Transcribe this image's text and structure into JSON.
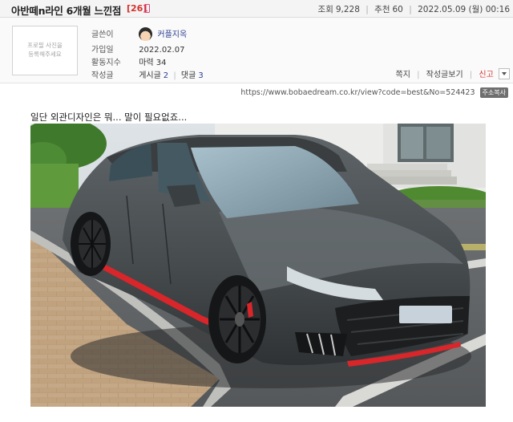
{
  "post": {
    "title": "아반떼n라인 6개월 느낀점",
    "comment_count": "[26]",
    "stats": {
      "views_label": "조회",
      "views": "9,228",
      "recommend_label": "추천",
      "recommend": "60",
      "date": "2022.05.09 (월) 00:16"
    }
  },
  "author": {
    "profile_placeholder_line1": "프로필 사진을",
    "profile_placeholder_line2": "등록해주세요",
    "writer_label": "글쓴이",
    "nickname": "커플지옥",
    "joined_label": "가입일",
    "joined": "2022.02.07",
    "activity_label": "활동지수",
    "activity": "마력 34",
    "posts_label": "작성글",
    "posts_text": "게시글",
    "posts_count": "2",
    "comments_text": "댓글",
    "comments_count": "3"
  },
  "actions": {
    "note": "쪽지",
    "view_posts": "작성글보기",
    "report": "신고"
  },
  "url": {
    "text": "https://www.bobaedream.co.kr/view?code=best&No=524423",
    "copy_label": "주소복사"
  },
  "content": {
    "text": "일단 외관디자인은 뭐... 말이 필요없죠..."
  },
  "icons": {
    "mobile": "mobile-phone-icon",
    "dropdown": "chevron-down-icon"
  },
  "colors": {
    "comment_count": "#d2322d",
    "nickname": "#2a3d8f",
    "report": "#d2322d",
    "car_body": "#4a4f52",
    "car_accent": "#d8262b"
  }
}
